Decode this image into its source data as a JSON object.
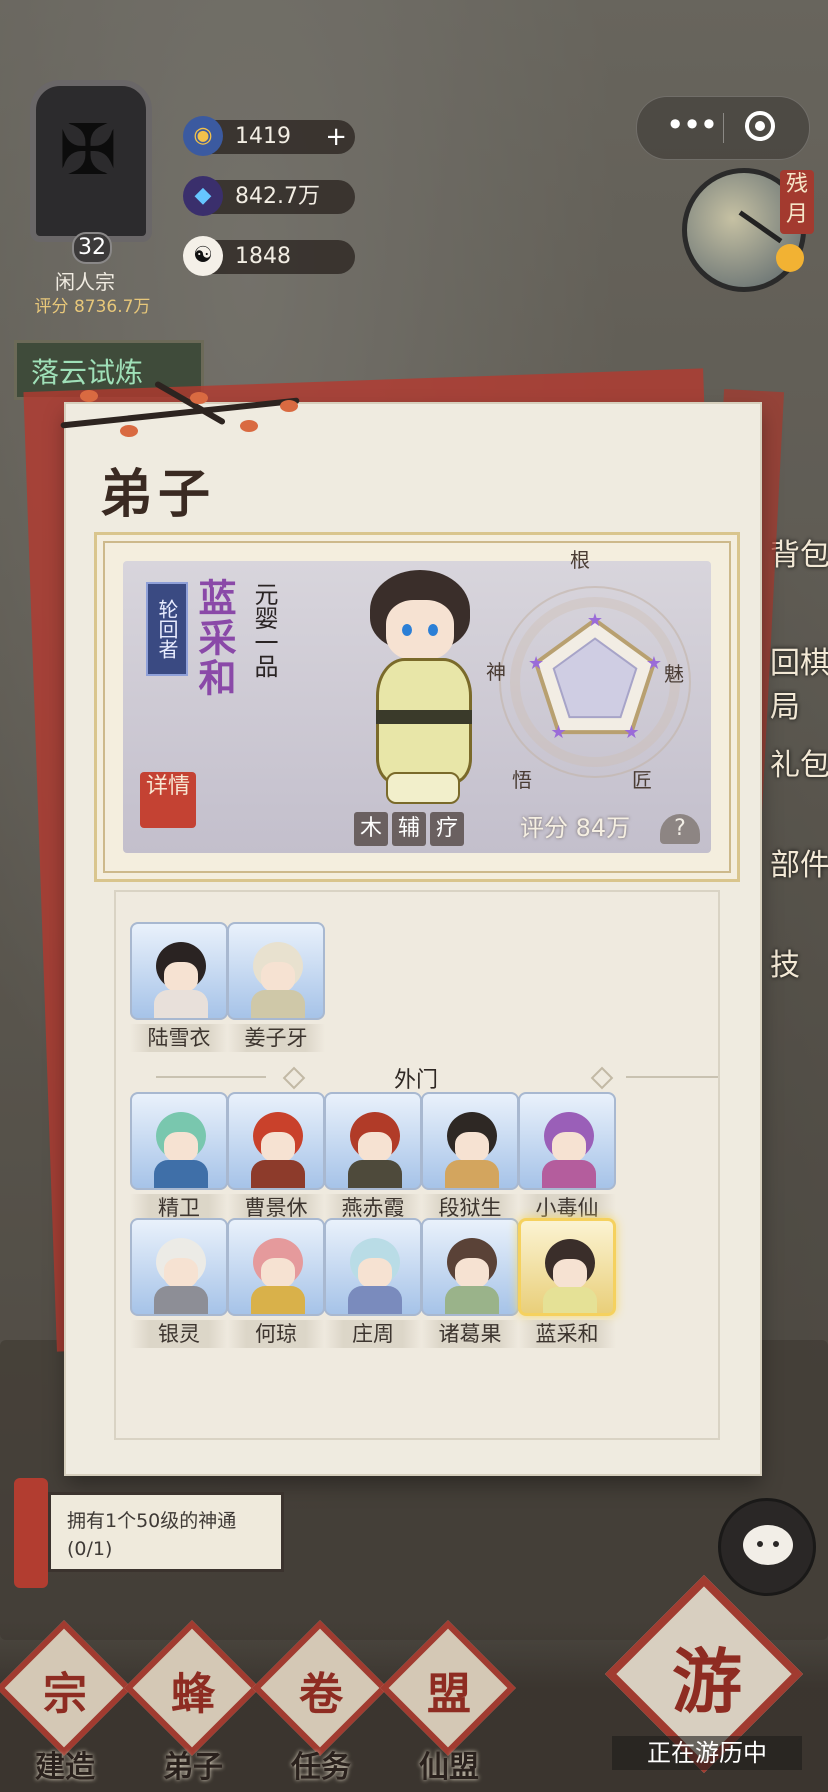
{
  "resources": [
    {
      "icon": "gem-coin-icon",
      "value": "1419",
      "has_plus": true
    },
    {
      "icon": "spirit-crystal-icon",
      "value": "842.7万"
    },
    {
      "icon": "yin-yang-icon",
      "value": "1848"
    }
  ],
  "sect": {
    "level": "32",
    "name": "闲人宗",
    "score": "评分 8736.7万"
  },
  "event": {
    "label": "落云试炼"
  },
  "moon": {
    "label": "残月"
  },
  "right_menu": [
    "背包",
    "回棋局",
    "礼包",
    "部件",
    "技"
  ],
  "panel": {
    "title": "弟子"
  },
  "hero": {
    "rank_tag": "轮回者",
    "name": "蓝采和",
    "realm": "元婴一品",
    "detail_label": "详情",
    "tags": [
      "木",
      "辅",
      "疗"
    ],
    "score": "评分 84万",
    "help": "?",
    "radar": {
      "labels": [
        "根",
        "魅",
        "匠",
        "悟",
        "神"
      ],
      "values": [
        0.35,
        0.35,
        0.35,
        0.35,
        0.35
      ]
    }
  },
  "disciples": {
    "core": [
      {
        "name": "陆雪衣",
        "hair": "#2a2322",
        "cloth": "#e8e0da"
      },
      {
        "name": "姜子牙",
        "hair": "#e8e1cf",
        "cloth": "#cfc8a8"
      }
    ],
    "section_label": "外门",
    "outer": [
      {
        "name": "精卫",
        "hair": "#79c7ae",
        "cloth": "#3f6fa8"
      },
      {
        "name": "曹景休",
        "hair": "#c9412b",
        "cloth": "#8d3b2b"
      },
      {
        "name": "燕赤霞",
        "hair": "#b13b28",
        "cloth": "#4e4a3b"
      },
      {
        "name": "段狱生",
        "hair": "#2e2824",
        "cloth": "#d3a55e"
      },
      {
        "name": "小毒仙",
        "hair": "#9a5fb8",
        "cloth": "#b45d9d"
      },
      {
        "name": "银灵",
        "hair": "#ecebe6",
        "cloth": "#8d8e96"
      },
      {
        "name": "何琼",
        "hair": "#e59a9c",
        "cloth": "#d9b14a"
      },
      {
        "name": "庄周",
        "hair": "#b9dce6",
        "cloth": "#7a8bbd"
      },
      {
        "name": "诸葛果",
        "hair": "#5a4237",
        "cloth": "#9ab38a"
      },
      {
        "name": "蓝采和",
        "hair": "#3a2e2a",
        "cloth": "#e5e196",
        "selected": true
      }
    ]
  },
  "quest": {
    "text": "拥有1个50级的神通(0/1)"
  },
  "nav": [
    {
      "label": "建造",
      "glyph": "宗"
    },
    {
      "label": "弟子",
      "glyph": "蜂"
    },
    {
      "label": "任务",
      "glyph": "卷"
    },
    {
      "label": "仙盟",
      "glyph": "盟"
    }
  ],
  "travel": {
    "label": "正在游历中",
    "glyph": "游"
  }
}
